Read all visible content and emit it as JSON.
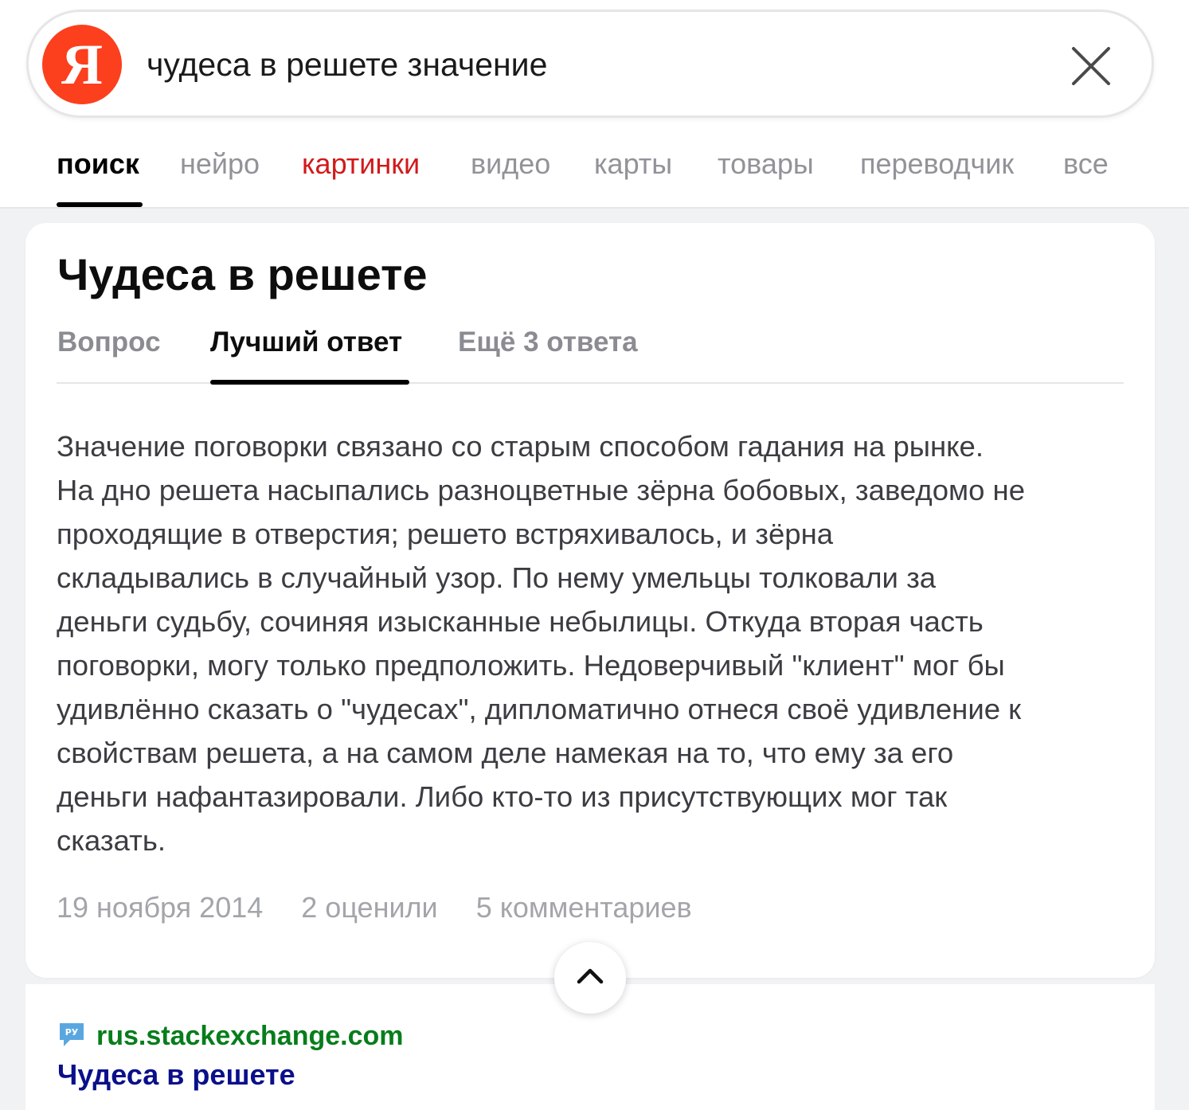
{
  "search": {
    "logo_letter": "Я",
    "query": "чудеса в решете значение"
  },
  "nav": {
    "items": [
      {
        "label": "поиск",
        "state": "active"
      },
      {
        "label": "нейро",
        "state": "normal"
      },
      {
        "label": "картинки",
        "state": "highlight"
      },
      {
        "label": "видео",
        "state": "normal"
      },
      {
        "label": "карты",
        "state": "normal"
      },
      {
        "label": "товары",
        "state": "normal"
      },
      {
        "label": "переводчик",
        "state": "normal"
      },
      {
        "label": "все",
        "state": "normal"
      }
    ]
  },
  "card": {
    "title": "Чудеса в решете",
    "tabs": [
      {
        "label": "Вопрос",
        "active": false
      },
      {
        "label": "Лучший ответ",
        "active": true
      },
      {
        "label": "Ещё 3 ответа",
        "active": false
      }
    ],
    "answer": {
      "lines": [
        "Значение поговорки связано со старым способом гадания на рынке.",
        "На дно решета насыпались разноцветные зёрна бобовых, заведомо не",
        "проходящие в отверстия; решето встряхивалось, и зёрна",
        "складывались в случайный узор. По нему умельцы толковали за",
        "деньги судьбу, сочиняя изысканные небылицы. Откуда вторая часть",
        "поговорки, могу только предположить. Недоверчивый \"клиент\" мог бы",
        "удивлённо сказать о \"чудесах\", дипломатично отнеся своё удивление к",
        "свойствам решета, а на самом деле намекая на то, что ему за его",
        "деньги нафантазировали. Либо кто-то из присутствующих мог так",
        "сказать."
      ]
    },
    "meta": {
      "date": "19 ноября 2014",
      "ratings": "2 оценили",
      "comments": "5 комментариев"
    }
  },
  "result": {
    "favicon_text": "РУ",
    "domain": "rus.stackexchange.com",
    "title": "Чудеса в решете"
  },
  "colors": {
    "logo": "#fc3f1d",
    "highlight_tab": "#d11a1a",
    "domain": "#077d1b",
    "result_title": "#0a0f8a",
    "favicon": "#5aa7e0"
  }
}
